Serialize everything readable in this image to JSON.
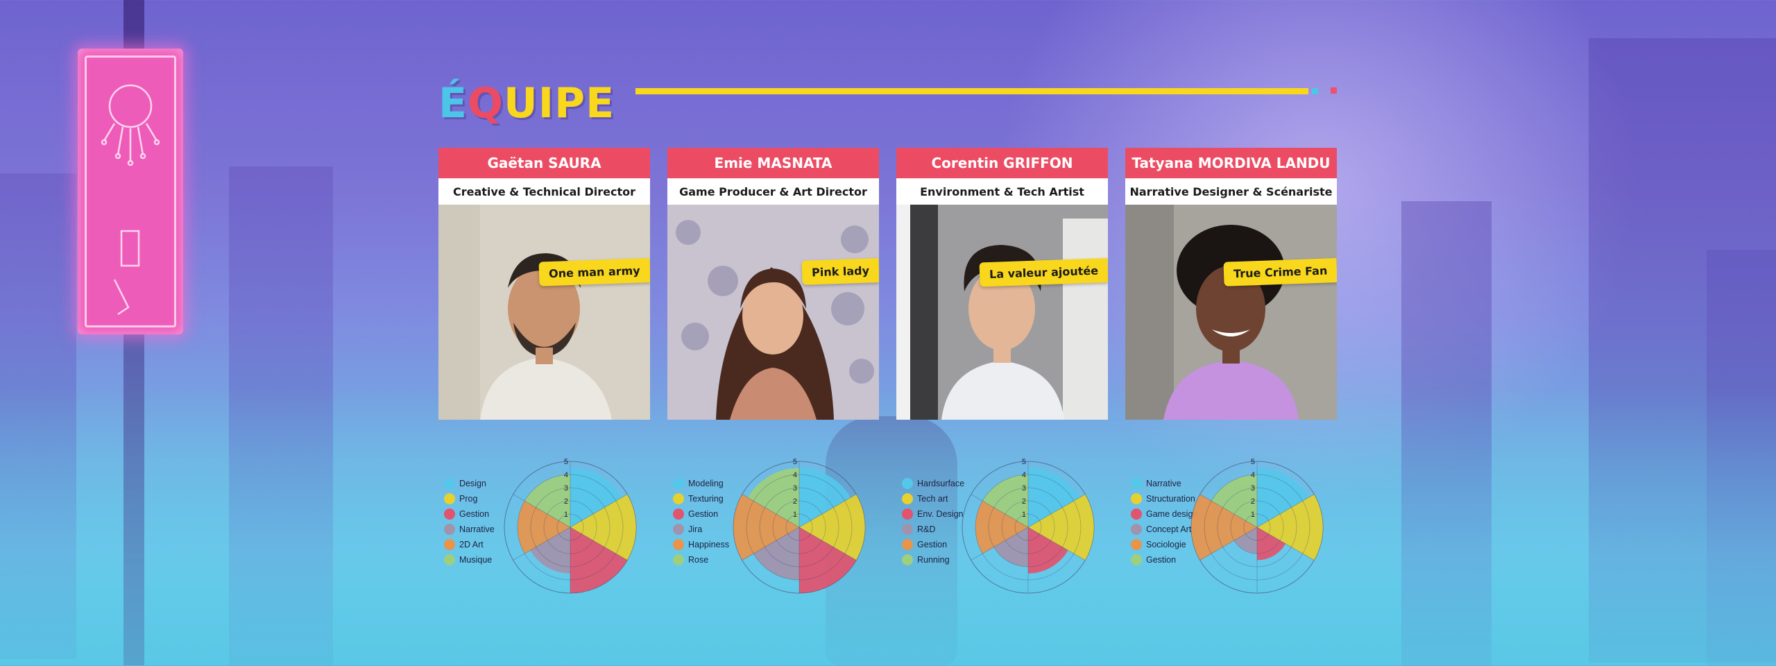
{
  "title": {
    "letters": [
      "É",
      "Q",
      "U",
      "I",
      "P",
      "E"
    ],
    "colors": [
      "#4cc6e8",
      "#ec4c63",
      "#f9d71c",
      "#f9d71c",
      "#f9d71c",
      "#f9d71c"
    ]
  },
  "colors": {
    "accent_red": "#ec4c63",
    "accent_yellow": "#f9d71c",
    "accent_cyan": "#4cc6e8",
    "neon_pink": "#ee5cb9"
  },
  "series_colors": [
    "#55c7ea",
    "#e6d12e",
    "#e2536d",
    "#a293ad",
    "#e8944a",
    "#9fcf7c"
  ],
  "radar_ticks": [
    "1",
    "2",
    "3",
    "4",
    "5"
  ],
  "team": [
    {
      "name": "Gaëtan SAURA",
      "role": "Creative & Technical Director",
      "tag": "One man army",
      "skills": [
        "Design",
        "Prog",
        "Gestion",
        "Narrative",
        "2D Art",
        "Musique"
      ],
      "values": [
        4.5,
        5,
        5,
        3.5,
        4,
        4
      ]
    },
    {
      "name": "Emie MASNATA",
      "role": "Game Producer & Art Director",
      "tag": "Pink lady",
      "skills": [
        "Modeling",
        "Texturing",
        "Gestion",
        "Jira",
        "Happiness",
        "Rose"
      ],
      "values": [
        4.5,
        5,
        5,
        4,
        5,
        4.5
      ]
    },
    {
      "name": "Corentin GRIFFON",
      "role": "Environment & Tech Artist",
      "tag": "La valeur ajoutée",
      "skills": [
        "Hardsurface",
        "Tech art",
        "Env. Design",
        "R&D",
        "Gestion",
        "Running"
      ],
      "values": [
        4.5,
        5,
        3.5,
        3,
        4,
        4
      ]
    },
    {
      "name": "Tatyana MORDIVA LANDU",
      "role": "Narrative Designer & Scénariste",
      "tag": "True Crime Fan",
      "skills": [
        "Narrative",
        "Structuration",
        "Game design",
        "Concept Art",
        "Sociologie",
        "Gestion"
      ],
      "values": [
        4.5,
        5,
        2.5,
        2,
        5,
        4
      ]
    }
  ]
}
